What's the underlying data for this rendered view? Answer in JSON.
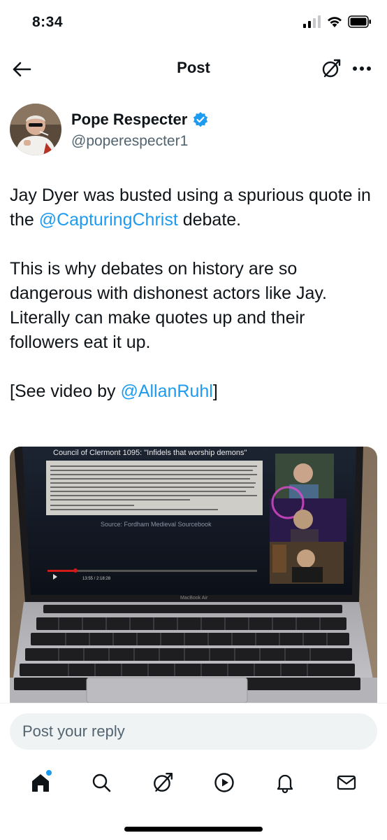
{
  "status_bar": {
    "time": "8:34"
  },
  "header": {
    "title": "Post"
  },
  "author": {
    "name": "Pope Respecter",
    "handle": "@poperespecter1",
    "verified_color": "#1d9bf0"
  },
  "post": {
    "p1_pre": "Jay Dyer was busted using a spurious quote in the ",
    "p1_mention": "@CapturingChrist",
    "p1_post": " debate.",
    "p2": "This is why debates on history are so dangerous with dishonest actors like Jay. Literally can make quotes up and their followers eat it up.",
    "p3_pre": "[See video by ",
    "p3_mention": "@AllanRuhl",
    "p3_post": "]"
  },
  "video": {
    "slide_title": "Council of Clermont 1095: \"Infidels that worship demons\"",
    "source": "Source: Fordham Medieval Sourcebook",
    "timestamp": "13:55 / 2:18:28",
    "laptop_label": "MacBook Air"
  },
  "reply": {
    "placeholder": "Post your reply"
  },
  "colors": {
    "accent": "#1d9bf0",
    "text": "#0f1419",
    "muted": "#536471"
  },
  "tabs": [
    "home-icon",
    "search-icon",
    "grok-icon",
    "video-icon",
    "notifications-icon",
    "messages-icon"
  ]
}
